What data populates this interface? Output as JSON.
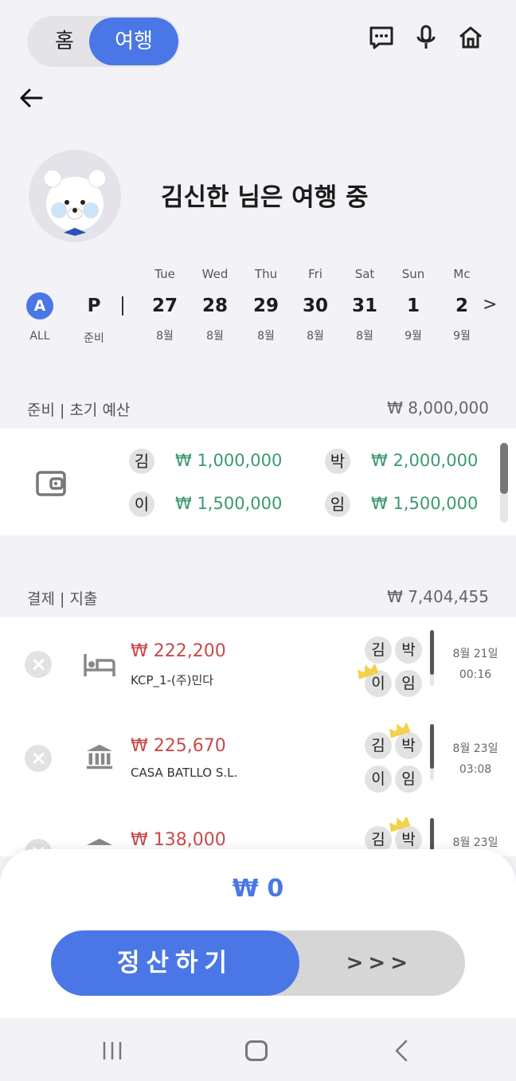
{
  "header": {
    "home_tab": "홈",
    "travel_tab": "여행",
    "icons": [
      "chat-icon",
      "mic-icon",
      "home-icon"
    ]
  },
  "profile": {
    "greeting": "김신한 님은 여행 중"
  },
  "calendar": {
    "all_letter": "A",
    "all_label": "ALL",
    "prep_letter": "P",
    "prep_label": "준비",
    "days": [
      {
        "dow": "Tue",
        "day": "27",
        "month": "8월"
      },
      {
        "dow": "Wed",
        "day": "28",
        "month": "8월"
      },
      {
        "dow": "Thu",
        "day": "29",
        "month": "8월"
      },
      {
        "dow": "Fri",
        "day": "30",
        "month": "8월"
      },
      {
        "dow": "Sat",
        "day": "31",
        "month": "8월"
      },
      {
        "dow": "Sun",
        "day": "1",
        "month": "9월"
      },
      {
        "dow": "Mc",
        "day": "2",
        "month": "9월"
      }
    ],
    "next": ">"
  },
  "budget": {
    "title": "준비 | 초기 예산",
    "total": "₩ 8,000,000",
    "members": [
      {
        "name": "김",
        "amount": "₩ 1,000,000"
      },
      {
        "name": "박",
        "amount": "₩ 2,000,000"
      },
      {
        "name": "이",
        "amount": "₩ 1,500,000"
      },
      {
        "name": "임",
        "amount": "₩ 1,500,000"
      }
    ]
  },
  "payments": {
    "title": "결제 | 지출",
    "total": "₩ 7,404,455",
    "items": [
      {
        "amount": "₩ 222,200",
        "merchant": "KCP_1-(주)민다",
        "date": "8월 21일",
        "time": "00:16",
        "members": [
          "김",
          "박",
          "이",
          "임"
        ],
        "category_icon": "bed-icon"
      },
      {
        "amount": "₩ 225,670",
        "merchant": "CASA BATLLO S.L.",
        "date": "8월 23일",
        "time": "03:08",
        "members": [
          "김",
          "박",
          "이",
          "임"
        ],
        "category_icon": "bank-icon"
      },
      {
        "amount": "₩ 138,000",
        "merchant": "",
        "date": "8월 23일",
        "time": "",
        "members": [
          "김",
          "박"
        ],
        "category_icon": "bank-icon"
      }
    ]
  },
  "settle": {
    "balance": "₩ 0",
    "button": "정산하기",
    "arrows": ">>>"
  },
  "colors": {
    "accent": "#4a77e5",
    "positive": "#3b9a6e",
    "negative": "#c94a4a"
  }
}
